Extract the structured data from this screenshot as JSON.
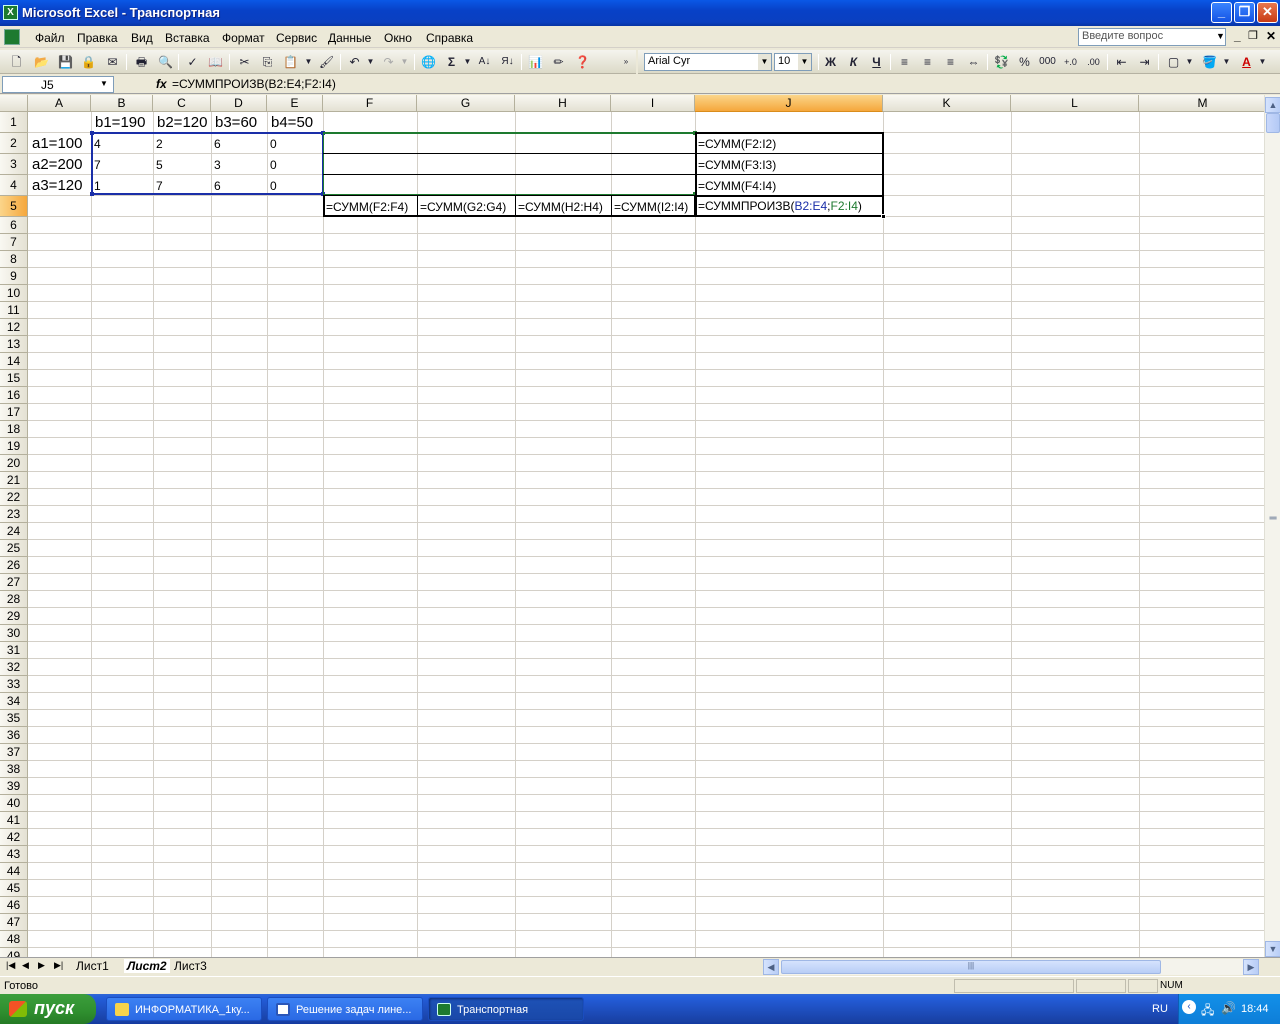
{
  "window": {
    "title": "Microsoft Excel - Транспортная",
    "app_icon": "excel-icon"
  },
  "menu": [
    "Файл",
    "Правка",
    "Вид",
    "Вставка",
    "Формат",
    "Сервис",
    "Данные",
    "Окно",
    "Справка"
  ],
  "help_placeholder": "Введите вопрос",
  "toolbar": {
    "font_name": "Arial Cyr",
    "font_size": "10",
    "bold": "Ж",
    "italic": "К",
    "underline": "Ч",
    "percent": "%",
    "thousands": "000",
    "sum": "Σ"
  },
  "formula_bar": {
    "cell_ref": "J5",
    "fx": "fx",
    "formula": "=СУММПРОИЗВ(B2:E4;F2:I4)"
  },
  "columns": [
    "A",
    "B",
    "C",
    "D",
    "E",
    "F",
    "G",
    "H",
    "I",
    "J",
    "K",
    "L",
    "M"
  ],
  "cells": {
    "B1": "b1=190",
    "C1": "b2=120",
    "D1": "b3=60",
    "E1": "b4=50",
    "A2": "a1=100",
    "A3": "a2=200",
    "A4": "a3=120",
    "B2": "4",
    "C2": "2",
    "D2": "6",
    "E2": "0",
    "B3": "7",
    "C3": "5",
    "D3": "3",
    "E3": "0",
    "B4": "1",
    "C4": "7",
    "D4": "6",
    "E4": "0",
    "J2": "=СУММ(F2:I2)",
    "J3": "=СУММ(F3:I3)",
    "J4": "=СУММ(F4:I4)",
    "F5": "=СУММ(F2:F4)",
    "G5": "=СУММ(G2:G4)",
    "H5": "=СУММ(H2:H4)",
    "I5": "=СУММ(I2:I4)",
    "J5_prefix": "=СУММПРОИЗВ(",
    "J5_ref1": "B2:E4",
    "J5_sep": ";",
    "J5_ref2": "F2:I4",
    "J5_suffix": ")"
  },
  "sheet_tabs": [
    "Лист1",
    "Лист2",
    "Лист3"
  ],
  "active_sheet": "Лист2",
  "status": {
    "left": "Готово",
    "num": "NUM"
  },
  "taskbar": {
    "start": "пуск",
    "items": [
      {
        "label": "ИНФОРМАТИКА_1ку...",
        "icon": "folder-icon"
      },
      {
        "label": "Решение задач лине...",
        "icon": "word-icon"
      },
      {
        "label": "Транспортная",
        "icon": "excel-icon"
      }
    ],
    "lang": "RU",
    "clock": "18:44"
  },
  "colors": {
    "selected_col": "#f5a73c",
    "range_blue": "#1a2ea8",
    "range_green": "#1d7a2f",
    "title_blue": "#0841c7"
  }
}
